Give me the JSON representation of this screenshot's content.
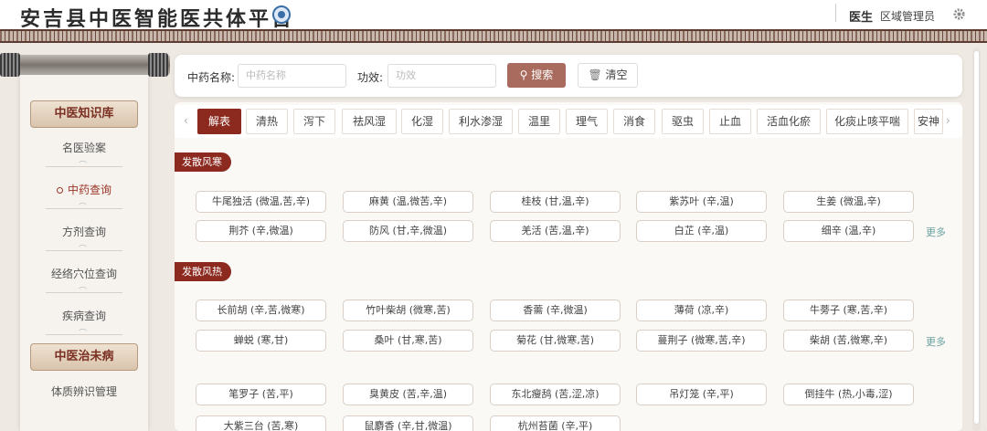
{
  "header": {
    "title": "安吉县中医智能医共体平台",
    "role": "医生",
    "user": "区域管理员",
    "settings_icon": "gear-icon"
  },
  "sidebar": {
    "sections": [
      {
        "label": "中医知识库"
      },
      {
        "label": "中医治未病"
      }
    ],
    "items": [
      {
        "label": "名医验案"
      },
      {
        "label": "中药查询"
      },
      {
        "label": "方剂查询"
      },
      {
        "label": "经络穴位查询"
      },
      {
        "label": "疾病查询"
      },
      {
        "label": "体质辨识管理"
      }
    ],
    "active_item": "中药查询"
  },
  "search": {
    "name_label": "中药名称:",
    "name_placeholder": "中药名称",
    "effect_label": "功效:",
    "effect_placeholder": "功效",
    "search_button": "搜索",
    "clear_button": "清空"
  },
  "tabs": [
    "解表",
    "清热",
    "泻下",
    "祛风湿",
    "化湿",
    "利水渗湿",
    "温里",
    "理气",
    "消食",
    "驱虫",
    "止血",
    "活血化瘀",
    "化痰止咳平喘",
    "安神"
  ],
  "categories": [
    {
      "name": "发散风寒",
      "more": "更多",
      "herbs": [
        "牛尾独活 (微温,苦,辛)",
        "麻黄 (温,微苦,辛)",
        "桂枝 (甘,温,辛)",
        "紫苏叶 (辛,温)",
        "生姜 (微温,辛)",
        "荆芥 (辛,微温)",
        "防风 (甘,辛,微温)",
        "羌活 (苦,温,辛)",
        "白芷 (辛,温)",
        "细辛 (温,辛)"
      ]
    },
    {
      "name": "发散风热",
      "more": "更多",
      "herbs": [
        "长前胡 (辛,苦,微寒)",
        "竹叶柴胡 (微寒,苦)",
        "香薷 (辛,微温)",
        "薄荷 (凉,辛)",
        "牛蒡子 (寒,苦,辛)",
        "蝉蜕 (寒,甘)",
        "桑叶 (甘,寒,苦)",
        "菊花 (甘,微寒,苦)",
        "蔓荆子 (微寒,苦,辛)",
        "柴胡 (苦,微寒,辛)"
      ]
    },
    {
      "name": "",
      "herbs": [
        "笔罗子 (苦,平)",
        "臭黄皮 (苦,辛,温)",
        "东北瘦鸹 (苦,涩,凉)",
        "吊灯笼 (辛,平)",
        "倒挂牛 (热,小毒,涩)",
        "大紫三台 (苦,寒)",
        "鼠麝香 (辛,甘,微温)",
        "杭州苔菌 (辛,平)"
      ]
    }
  ],
  "colors": {
    "accent": "#8c2a1f",
    "search_button": "#a86b5d",
    "more_link": "#6aa3a0"
  }
}
